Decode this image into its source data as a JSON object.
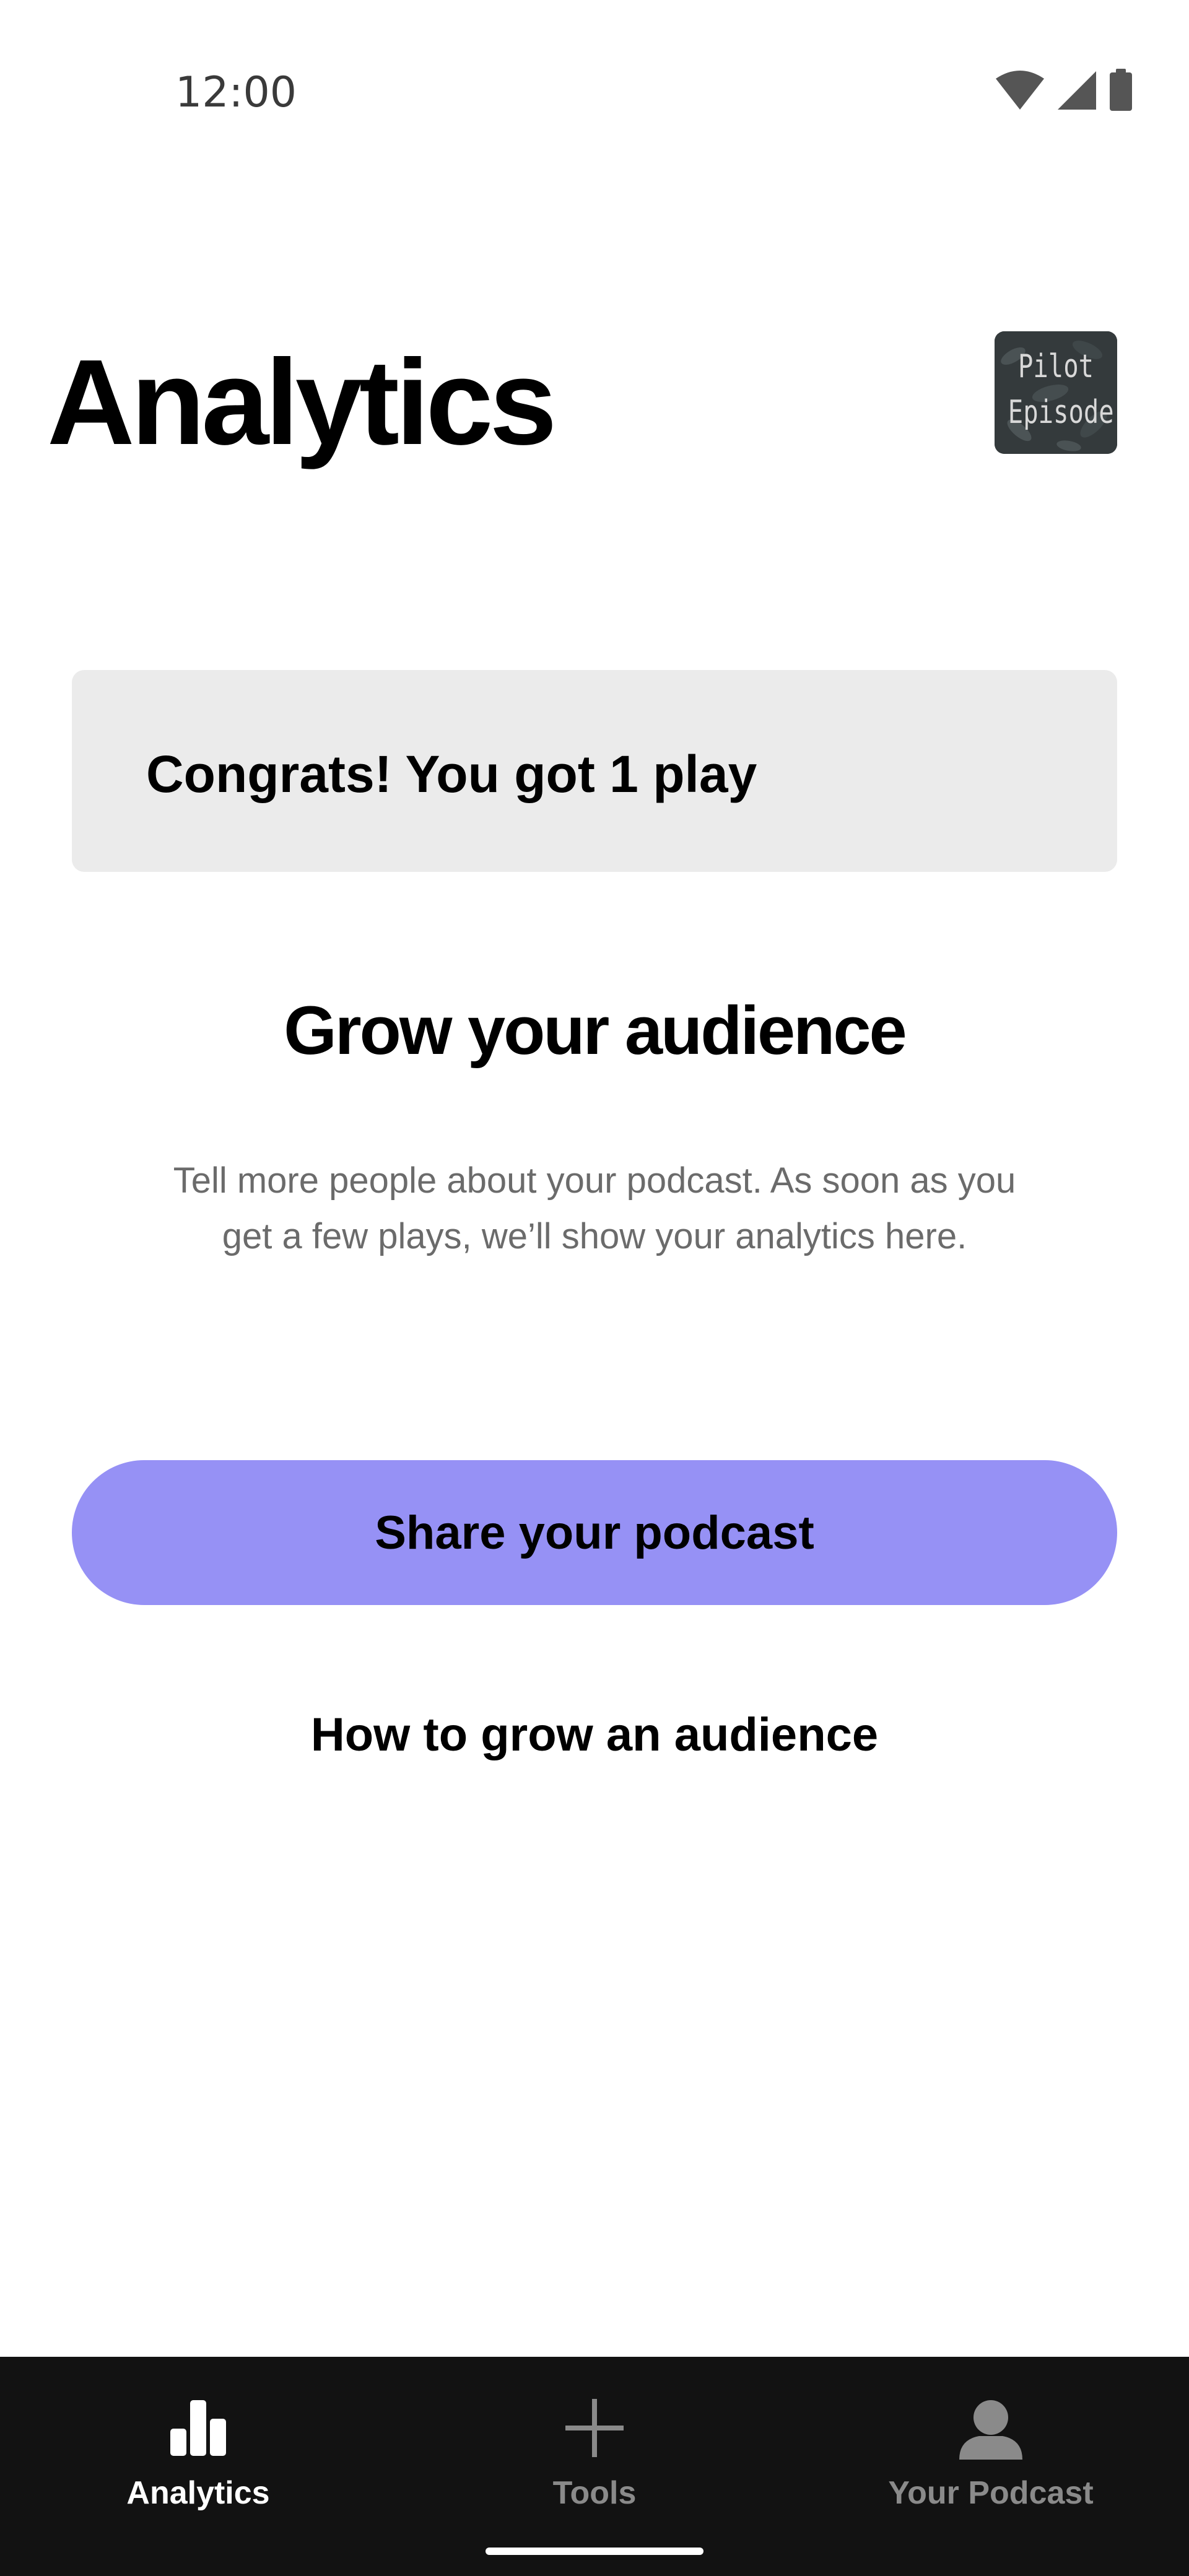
{
  "status_bar": {
    "time": "12:00",
    "icons": [
      "wifi-icon",
      "cellular-signal-icon",
      "battery-icon"
    ]
  },
  "header": {
    "title": "Analytics",
    "episode_thumbnail": {
      "line1": "Pilot",
      "line2": "Episode"
    }
  },
  "banner": {
    "text": "Congrats! You got 1 play"
  },
  "grow": {
    "title": "Grow your audience",
    "description": "Tell more people about your podcast. As soon as you get a few plays, we’ll show your analytics here."
  },
  "actions": {
    "share_label": "Share your podcast",
    "howto_label": "How to grow an audience"
  },
  "bottom_nav": {
    "items": [
      {
        "label": "Analytics",
        "icon": "bar-chart-icon",
        "active": true
      },
      {
        "label": "Tools",
        "icon": "plus-icon",
        "active": false
      },
      {
        "label": "Your Podcast",
        "icon": "person-icon",
        "active": false
      }
    ]
  },
  "colors": {
    "accent": "#9691f5",
    "banner_bg": "#ebebeb",
    "nav_bg": "#121212"
  }
}
